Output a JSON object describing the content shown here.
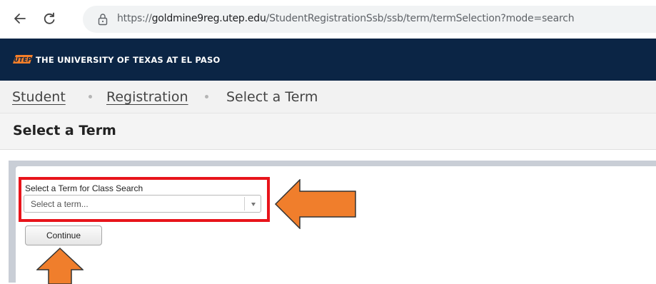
{
  "browser": {
    "url_prefix": "https://",
    "url_host": "goldmine9reg.utep.edu",
    "url_path": "/StudentRegistrationSsb/ssb/term/termSelection?mode=search"
  },
  "header": {
    "university_name": "THE UNIVERSITY OF TEXAS AT EL PASO",
    "logo_text": "UTEP"
  },
  "breadcrumb": {
    "items": [
      {
        "label": "Student"
      },
      {
        "label": "Registration"
      },
      {
        "label": "Select a Term"
      }
    ]
  },
  "page": {
    "title": "Select a Term"
  },
  "form": {
    "term_label": "Select a Term for Class Search",
    "term_placeholder": "Select a term...",
    "continue_label": "Continue"
  },
  "colors": {
    "header_bg": "#0b2545",
    "highlight": "#e8141b",
    "arrow": "#f07e2c"
  }
}
